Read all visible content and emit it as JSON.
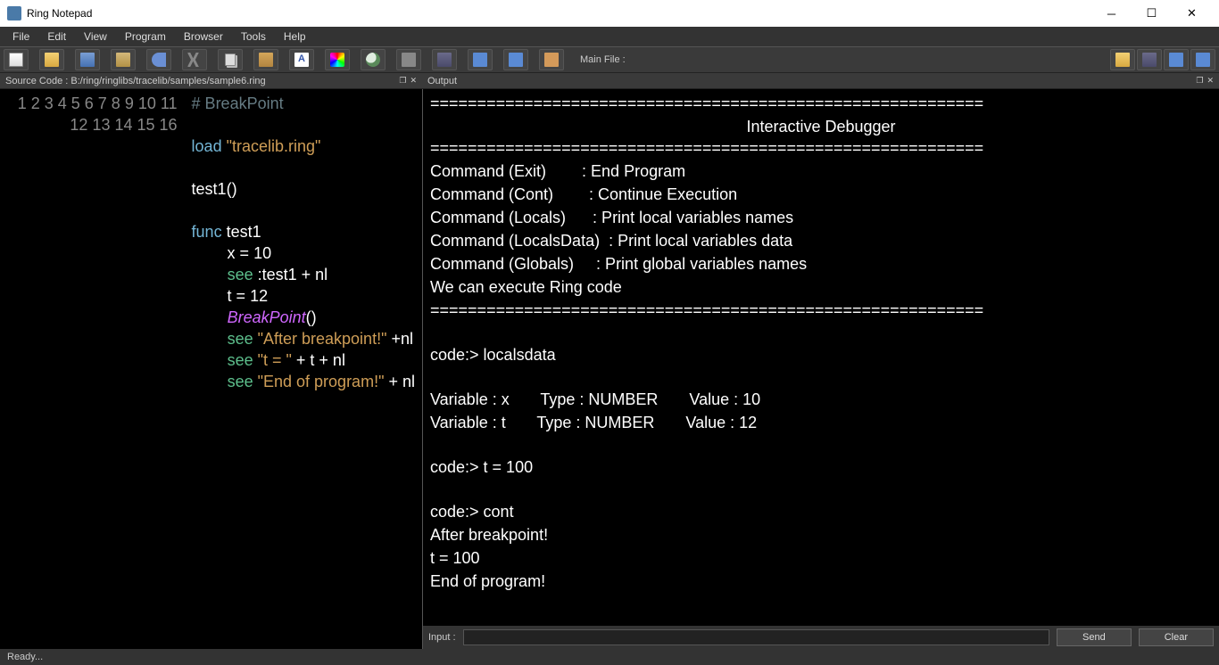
{
  "title": "Ring Notepad",
  "menus": [
    "File",
    "Edit",
    "View",
    "Program",
    "Browser",
    "Tools",
    "Help"
  ],
  "toolbar": {
    "mainfile_label": "Main File :"
  },
  "source_panel": {
    "label": "Source Code : B:/ring/ringlibs/tracelib/samples/sample6.ring",
    "line_count": 16,
    "code": {
      "l1_comment": "# BreakPoint",
      "l3_load": "load",
      "l3_str": "\"tracelib.ring\"",
      "l5": "test1()",
      "l7_func": "func",
      "l7_name": " test1",
      "l8": "        x = 10",
      "l9_see": "see",
      "l9_rest": " :test1 + nl",
      "l10": "        t = 12",
      "l11_pad": "        ",
      "l11_bp": "BreakPoint",
      "l11_rest": "()",
      "l12_see": "see",
      "l12_str": "\"After breakpoint!\"",
      "l12_rest": " +nl",
      "l13_see": "see",
      "l13_str": "\"t = \"",
      "l13_rest": " + t + nl",
      "l14_see": "see",
      "l14_str": "\"End of program!\"",
      "l14_rest": " + nl"
    }
  },
  "output_panel": {
    "label": "Output",
    "divider": "===========================================================",
    "title": "Interactive Debugger",
    "cmd_exit": "Command (Exit)        : End Program",
    "cmd_cont": "Command (Cont)        : Continue Execution",
    "cmd_locals": "Command (Locals)      : Print local variables names",
    "cmd_localsdata": "Command (LocalsData)  : Print local variables data",
    "cmd_globals": "Command (Globals)     : Print global variables names",
    "exec_note": "We can execute Ring code",
    "p1": "code:> localsdata",
    "v1": "Variable : x       Type : NUMBER       Value : 10",
    "v2": "Variable : t       Type : NUMBER       Value : 12",
    "p2": "code:> t = 100",
    "p3": "code:> cont",
    "o1": "After breakpoint!",
    "o2": "t = 100",
    "o3": "End of program!"
  },
  "input": {
    "label": "Input :",
    "send": "Send",
    "clear": "Clear"
  },
  "status": "Ready..."
}
